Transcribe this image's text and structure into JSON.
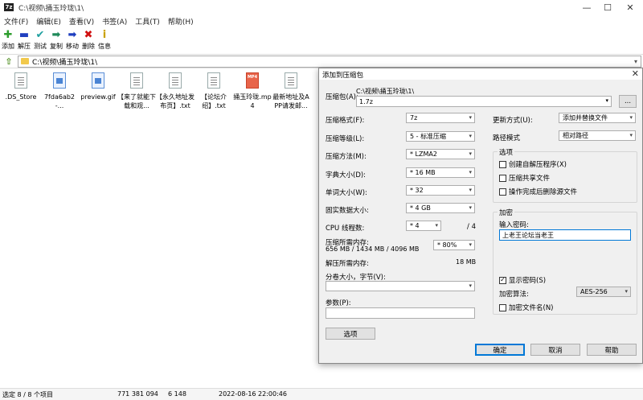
{
  "window": {
    "title": "C:\\视频\\捅玉玲珑\\1\\",
    "icon_text": "7z"
  },
  "menu": [
    "文件(F)",
    "编辑(E)",
    "查看(V)",
    "书签(A)",
    "工具(T)",
    "帮助(H)"
  ],
  "toolbar": [
    {
      "label": "添加",
      "glyph": "✚",
      "color": "#2e9e2e",
      "icon": "add-icon"
    },
    {
      "label": "解压",
      "glyph": "▬",
      "color": "#1f3fbf",
      "icon": "extract-icon"
    },
    {
      "label": "测试",
      "glyph": "✔",
      "color": "#20a0a0",
      "icon": "test-icon"
    },
    {
      "label": "复制",
      "glyph": "➡",
      "color": "#1f8a5a",
      "icon": "copy-icon"
    },
    {
      "label": "移动",
      "glyph": "➡",
      "color": "#1f3fbf",
      "icon": "move-icon"
    },
    {
      "label": "删除",
      "glyph": "✖",
      "color": "#d01010",
      "icon": "delete-icon"
    },
    {
      "label": "信息",
      "glyph": "i",
      "color": "#c9a000",
      "icon": "info-icon"
    }
  ],
  "address": {
    "path": "C:\\视频\\捅玉玲珑\\1\\"
  },
  "files": [
    {
      "name": ".DS_Store",
      "type": "txt"
    },
    {
      "name": "7fda6ab2-...",
      "type": "img"
    },
    {
      "name": "preview.gif",
      "type": "img"
    },
    {
      "name": "【来了就能下载和观...",
      "type": "txt"
    },
    {
      "name": "【永久地址发布页】.txt",
      "type": "txt"
    },
    {
      "name": "【论坛介绍】.txt",
      "type": "txt"
    },
    {
      "name": "捅玉玲珑.mp4",
      "type": "mp4",
      "badge": "MP4"
    },
    {
      "name": "最新地址及APP请发邮...",
      "type": "txt"
    }
  ],
  "status": {
    "selection": "选定 8 / 8 个项目",
    "size": "771 381 094",
    "packed": "6 148",
    "modified": "2022-08-16 22:00:46"
  },
  "dialog": {
    "title": "添加到压缩包",
    "archive_label": "压缩包(A):",
    "archive_dir": "C:\\视频\\捅玉玲珑\\1\\",
    "archive_name": "1.7z",
    "browse_label": "...",
    "format_label": "压缩格式(F):",
    "format_value": "7z",
    "level_label": "压缩等级(L):",
    "level_value": "5 - 标准压缩",
    "method_label": "压缩方法(M):",
    "method_value": "* LZMA2",
    "dict_label": "字典大小(D):",
    "dict_value": "* 16 MB",
    "word_label": "单词大小(W):",
    "word_value": "* 32",
    "solid_label": "固实数据大小:",
    "solid_value": "* 4 GB",
    "cpu_label": "CPU 线程数:",
    "cpu_value": "* 4",
    "cpu_total": "/ 4",
    "mem_label": "压缩所需内存:",
    "mem_values": "656 MB / 1434 MB / 4096 MB",
    "mem_pct": "* 80%",
    "demem_label": "解压所需内存:",
    "demem_value": "18 MB",
    "split_label": "分卷大小，字节(V):",
    "params_label": "参数(P):",
    "options_button": "选项",
    "update_label": "更新方式(U):",
    "update_value": "添加并替换文件",
    "path_label": "路径模式",
    "path_value": "相对路径",
    "options_group": "选项",
    "opt_sfx": "创建自解压程序(X)",
    "opt_shared": "压缩共享文件",
    "opt_delete": "操作完成后删除源文件",
    "enc_group": "加密",
    "pwd_label": "输入密码:",
    "pwd_value": "上老王论坛当老王",
    "show_pwd": "显示密码(S)",
    "enc_method_label": "加密算法:",
    "enc_method_value": "AES-256",
    "enc_names": "加密文件名(N)",
    "ok": "确定",
    "cancel": "取消",
    "help": "帮助"
  }
}
